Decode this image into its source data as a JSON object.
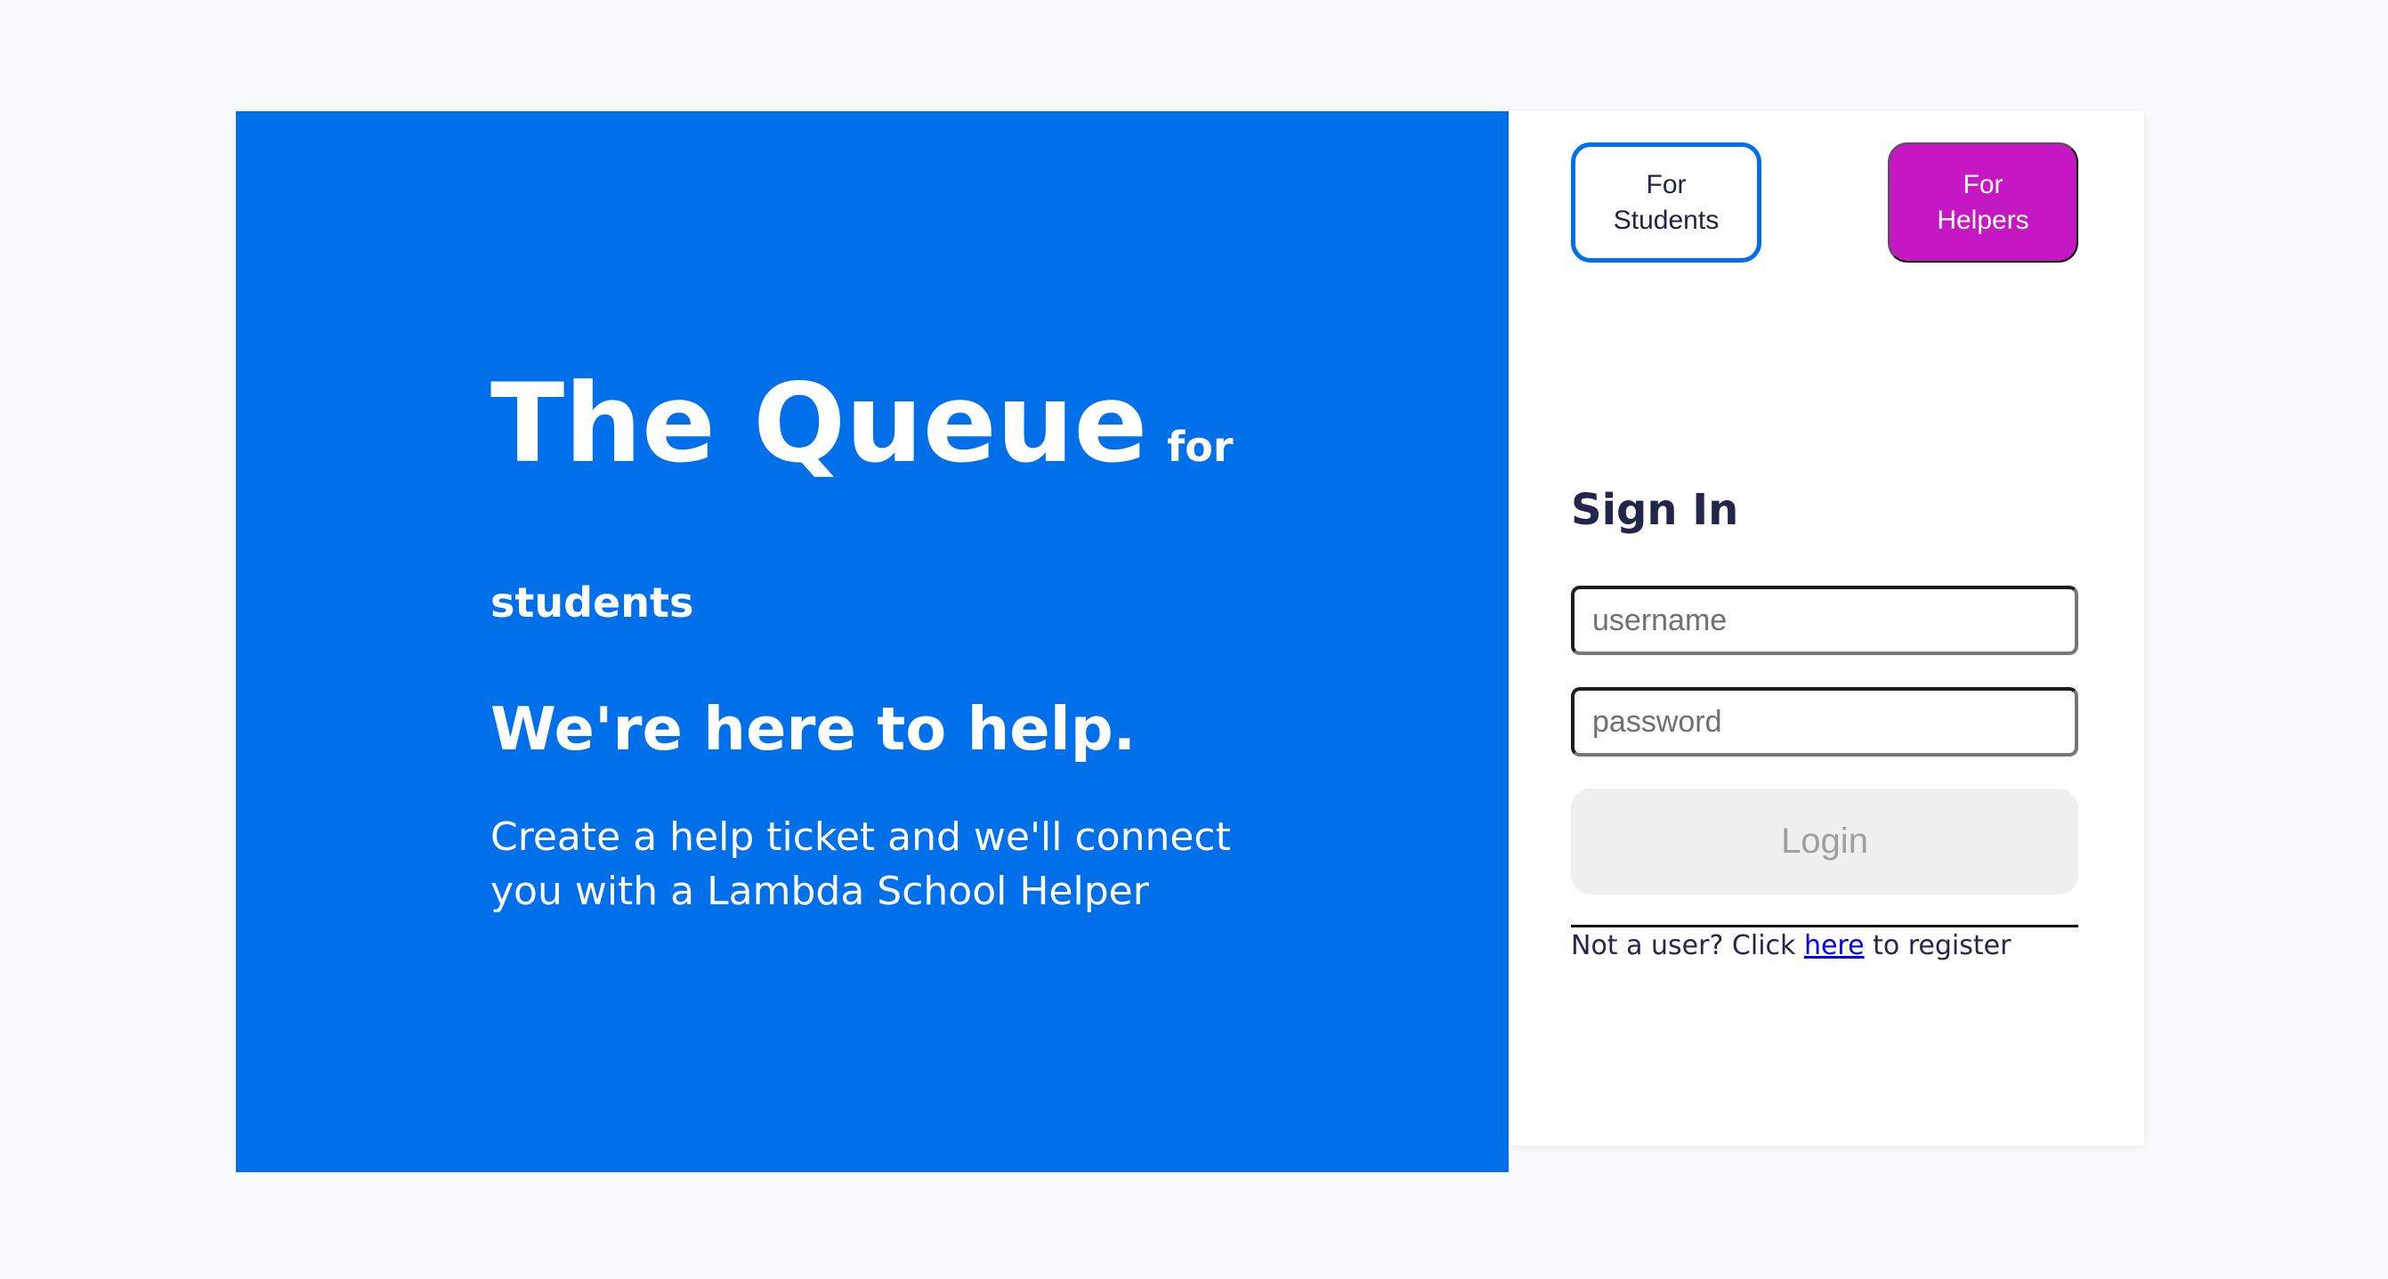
{
  "hero": {
    "app_name": "The Queue",
    "for_word": "for",
    "audience": "students",
    "tagline": "We're here to help.",
    "description": "Create a help ticket and we'll connect you with a Lambda School Helper"
  },
  "role_switch": {
    "students_label": "For Students",
    "helpers_label": "For Helpers"
  },
  "signin": {
    "title": "Sign In",
    "username_placeholder": "username",
    "password_placeholder": "password",
    "login_label": "Login",
    "register_prefix": "Not a user? Click ",
    "register_link": "here",
    "register_suffix": " to register"
  },
  "colors": {
    "primary_blue": "#0070ea",
    "helpers_magenta": "#c517c3",
    "text_dark": "#23264a"
  }
}
